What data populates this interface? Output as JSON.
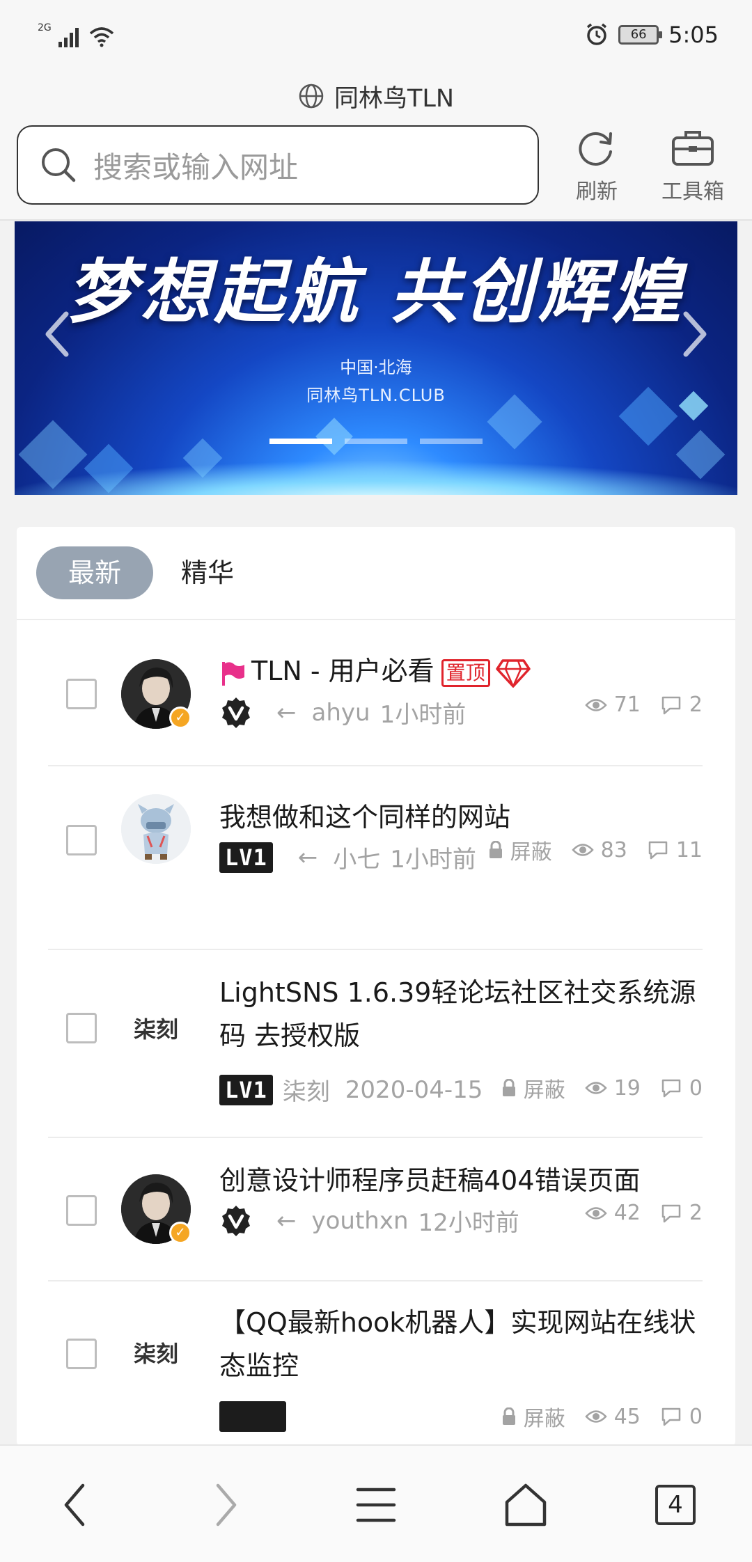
{
  "status_bar": {
    "network": "2G",
    "battery": "66",
    "time": "5:05"
  },
  "header": {
    "site_title": "同林鸟TLN"
  },
  "search": {
    "placeholder": "搜索或输入网址"
  },
  "toolbar": {
    "refresh_label": "刷新",
    "toolbox_label": "工具箱"
  },
  "banner": {
    "headline": "梦想起航 共创辉煌",
    "location": "中国·北海",
    "site": "同林鸟TLN.CLUB",
    "slide_count": 3,
    "active_slide": 1
  },
  "tabs": {
    "latest": "最新",
    "featured": "精华"
  },
  "posts": [
    {
      "title": "TLN - 用户必看",
      "pin_label": "置顶",
      "badge": "verified",
      "arrow": "←",
      "author": "ahyu",
      "time": "1小时前",
      "views": "71",
      "comments": "2"
    },
    {
      "title": "我想做和这个同样的网站",
      "level": "LV1",
      "arrow": "←",
      "author": "小七",
      "time": "1小时前",
      "blocked": "屏蔽",
      "views": "83",
      "comments": "11"
    },
    {
      "title": "LightSNS 1.6.39轻论坛社区社交系统源码 去授权版",
      "level": "LV1",
      "author": "柒刻",
      "time": "2020-04-15",
      "blocked": "屏蔽",
      "views": "19",
      "comments": "0",
      "avatar_text": "柒刻"
    },
    {
      "title": "创意设计师程序员赶稿404错误页面",
      "badge": "verified",
      "arrow": "←",
      "author": "youthxn",
      "time": "12小时前",
      "views": "42",
      "comments": "2"
    },
    {
      "title": "【QQ最新hook机器人】实现网站在线状态监控",
      "blocked": "屏蔽",
      "views": "45",
      "comments": "0",
      "avatar_text": "柒刻"
    }
  ],
  "bottom_nav": {
    "tab_count": "4"
  },
  "colors": {
    "accent_pill": "#98a4b2",
    "pin_red": "#e0242c",
    "verify_orange": "#f5a623"
  }
}
